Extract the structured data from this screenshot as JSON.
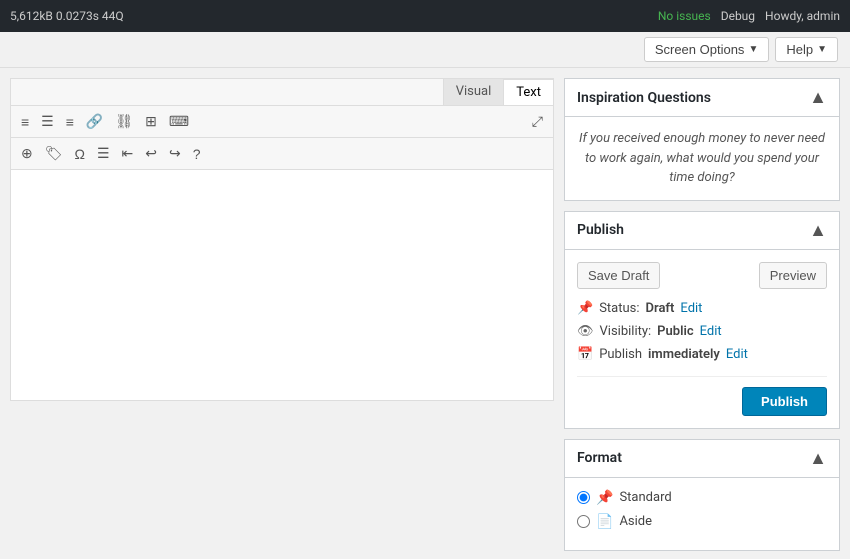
{
  "topbar": {
    "stats": "5,612kB  0.0273s  44Q",
    "no_issues": "No issues",
    "debug": "Debug",
    "howdy": "Howdy, admin"
  },
  "adminbar": {
    "screen_options_label": "Screen Options",
    "help_label": "Help"
  },
  "editor": {
    "tab_visual": "Visual",
    "tab_text": "Text",
    "toolbar": {
      "row1_icons": [
        "align-left",
        "align-center",
        "align-right",
        "link",
        "unlink",
        "table",
        "keyboard-shortcuts"
      ],
      "row2_icons": [
        "insert-more",
        "tag",
        "omega",
        "list",
        "outdent",
        "undo",
        "redo",
        "help"
      ]
    }
  },
  "sidebar": {
    "inspiration": {
      "title": "Inspiration Questions",
      "text": "If you received enough money to never need to work again, what would you spend your time doing?"
    },
    "publish": {
      "title": "Publish",
      "save_draft_label": "Save Draft",
      "preview_label": "Preview",
      "status_label": "Status:",
      "status_value": "Draft",
      "status_edit": "Edit",
      "visibility_label": "Visibility:",
      "visibility_value": "Public",
      "visibility_edit": "Edit",
      "publish_time_label": "Publish",
      "publish_time_value": "immediately",
      "publish_time_edit": "Edit",
      "publish_btn_label": "Publish"
    },
    "format": {
      "title": "Format",
      "options": [
        {
          "value": "standard",
          "label": "Standard",
          "icon": "📌",
          "checked": true
        },
        {
          "value": "aside",
          "label": "Aside",
          "icon": "📄",
          "checked": false
        }
      ]
    }
  }
}
